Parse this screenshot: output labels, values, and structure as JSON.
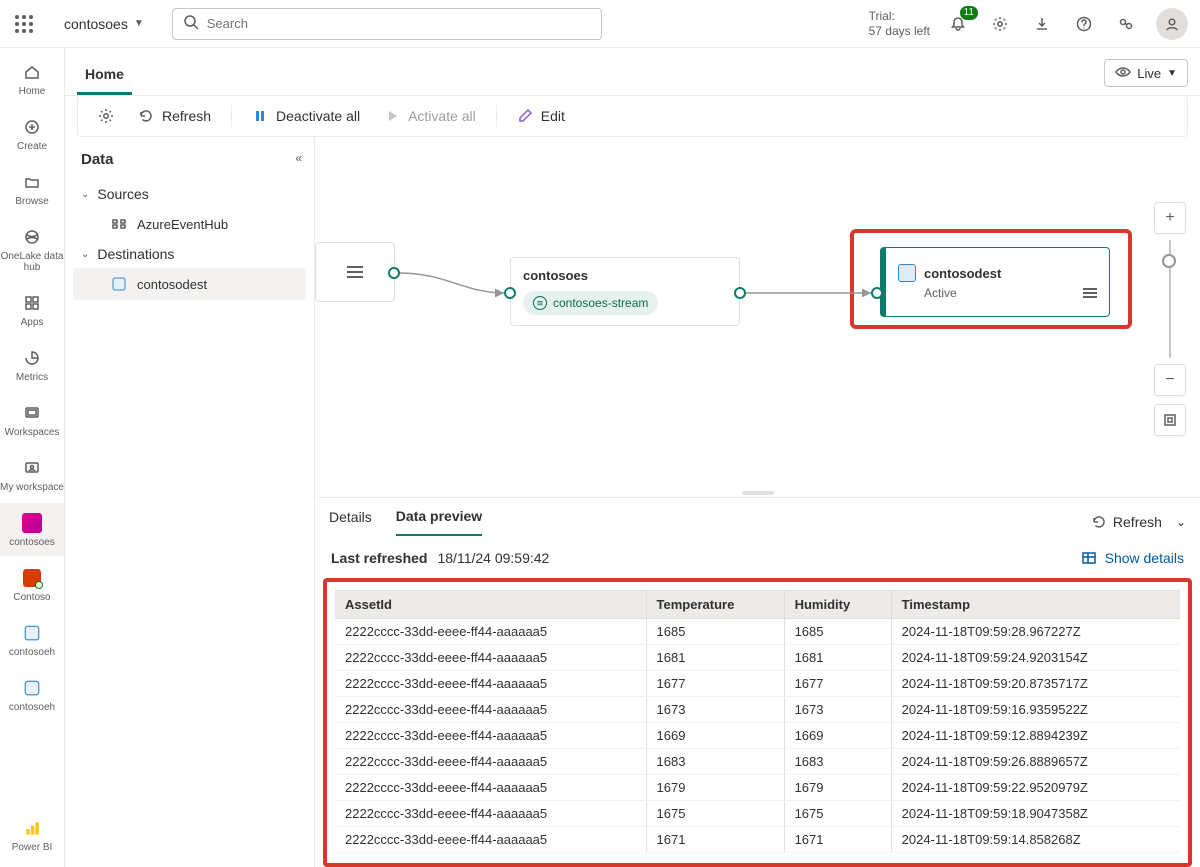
{
  "tenant": {
    "name": "contosoes"
  },
  "search": {
    "placeholder": "Search"
  },
  "trial": {
    "line1": "Trial:",
    "line2": "57 days left"
  },
  "notifications": {
    "count": "11"
  },
  "leftnav": {
    "home": "Home",
    "create": "Create",
    "browse": "Browse",
    "onelake": "OneLake data hub",
    "apps": "Apps",
    "metrics": "Metrics",
    "workspaces": "Workspaces",
    "myws": "My workspace",
    "contosoes": "contosoes",
    "contoso": "Contoso",
    "contosoeh": "contosoeh",
    "contosoeh2": "contosoeh",
    "powerbi": "Power BI"
  },
  "tab": {
    "home": "Home"
  },
  "live": {
    "label": "Live"
  },
  "cmd": {
    "refresh": "Refresh",
    "deactivate": "Deactivate all",
    "activate": "Activate all",
    "edit": "Edit"
  },
  "datapanel": {
    "title": "Data",
    "sources": "Sources",
    "source1": "AzureEventHub",
    "destinations": "Destinations",
    "dest1": "contosodest"
  },
  "canvas": {
    "stream_name": "contosoes",
    "stream_pill": "contosoes-stream",
    "dest_name": "contosodest",
    "dest_status": "Active"
  },
  "preview": {
    "tab_details": "Details",
    "tab_data": "Data preview",
    "refresh": "Refresh",
    "last_refreshed_lbl": "Last refreshed",
    "last_refreshed_val": "18/11/24 09:59:42",
    "show_details": "Show details",
    "columns": [
      "AssetId",
      "Temperature",
      "Humidity",
      "Timestamp"
    ],
    "rows": [
      [
        "2222cccc-33dd-eeee-ff44-aaaaaa5",
        "1685",
        "1685",
        "2024-11-18T09:59:28.967227Z"
      ],
      [
        "2222cccc-33dd-eeee-ff44-aaaaaa5",
        "1681",
        "1681",
        "2024-11-18T09:59:24.9203154Z"
      ],
      [
        "2222cccc-33dd-eeee-ff44-aaaaaa5",
        "1677",
        "1677",
        "2024-11-18T09:59:20.8735717Z"
      ],
      [
        "2222cccc-33dd-eeee-ff44-aaaaaa5",
        "1673",
        "1673",
        "2024-11-18T09:59:16.9359522Z"
      ],
      [
        "2222cccc-33dd-eeee-ff44-aaaaaa5",
        "1669",
        "1669",
        "2024-11-18T09:59:12.8894239Z"
      ],
      [
        "2222cccc-33dd-eeee-ff44-aaaaaa5",
        "1683",
        "1683",
        "2024-11-18T09:59:26.8889657Z"
      ],
      [
        "2222cccc-33dd-eeee-ff44-aaaaaa5",
        "1679",
        "1679",
        "2024-11-18T09:59:22.9520979Z"
      ],
      [
        "2222cccc-33dd-eeee-ff44-aaaaaa5",
        "1675",
        "1675",
        "2024-11-18T09:59:18.9047358Z"
      ],
      [
        "2222cccc-33dd-eeee-ff44-aaaaaa5",
        "1671",
        "1671",
        "2024-11-18T09:59:14.858268Z"
      ]
    ]
  }
}
